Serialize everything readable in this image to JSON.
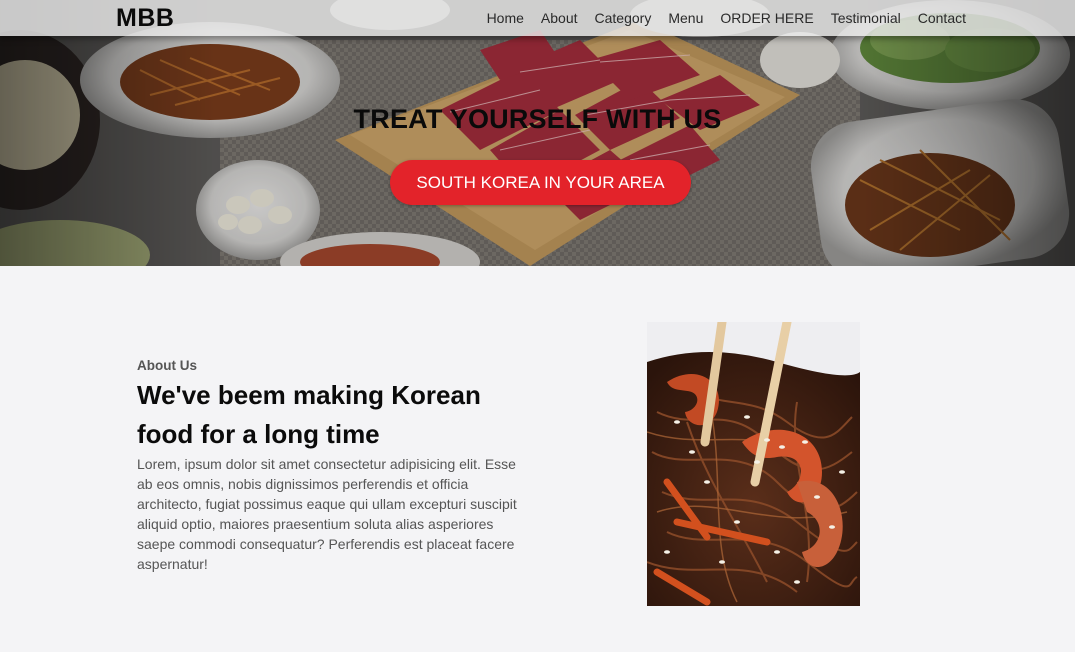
{
  "navbar": {
    "logo": "MBB",
    "links": [
      "Home",
      "About",
      "Category",
      "Menu",
      "ORDER HERE",
      "Testimonial",
      "Contact"
    ]
  },
  "hero": {
    "title": "TREAT YOURSELF WITH US",
    "button_label": "SOUTH KOREA IN YOUR AREA",
    "accent_color": "#e3232a"
  },
  "about": {
    "eyebrow": "About Us",
    "heading": "We've beem making Korean food for a long time",
    "body": "Lorem, ipsum dolor sit amet consectetur adipisicing elit. Esse ab eos omnis, nobis dignissimos perferendis et officia architecto, fugiat possimus eaque qui ullam excepturi suscipit aliquid optio, maiores praesentium soluta alias asperiores saepe commodi consequatur? Perferendis est placeat facere aspernatur!"
  }
}
